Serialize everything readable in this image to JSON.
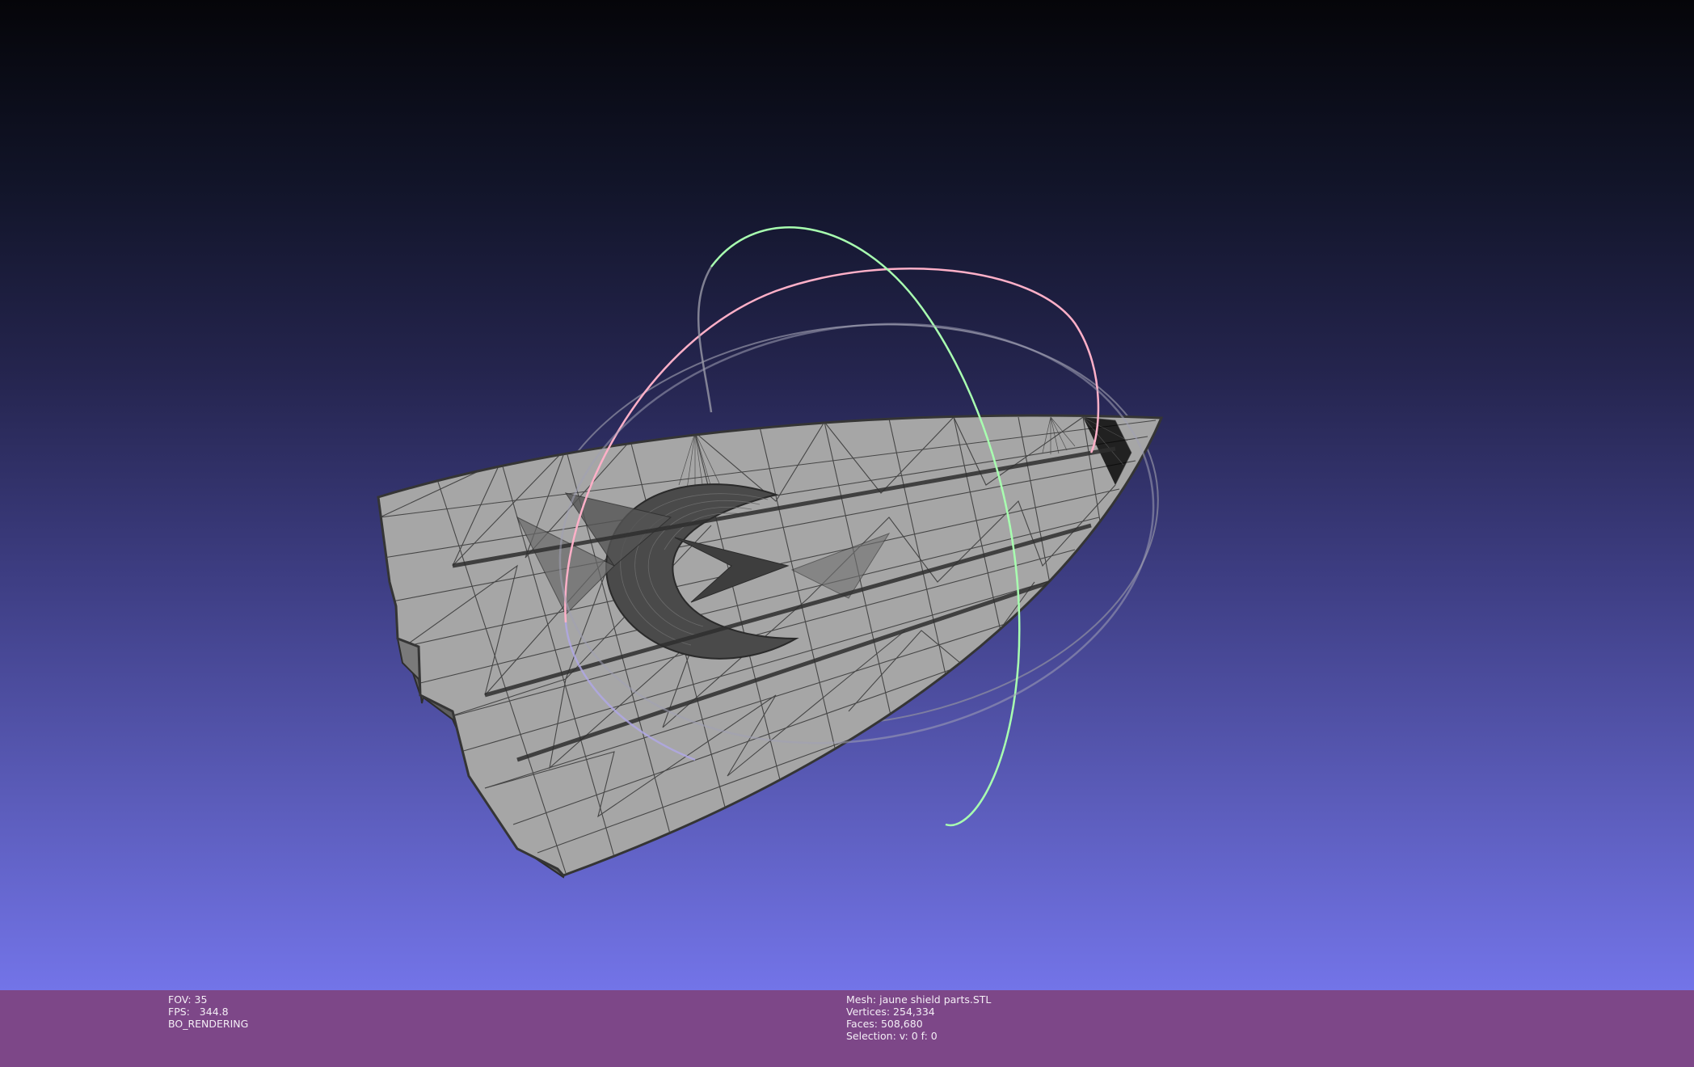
{
  "viewport": {
    "background_top": "#050509",
    "background_bottom": "#7374e8",
    "mesh_fill": "#a6a6a6",
    "wire_color": "#3a3a3a",
    "trackball_colors": {
      "x_ring": "#a8ffb0",
      "y_ring": "#ffb0c8",
      "z_ring": "#9a9aa8"
    }
  },
  "info_bar": {
    "color": "#7d4788",
    "left": {
      "fov": "FOV: 35",
      "fps": "FPS:   344.8",
      "mode": "BO_RENDERING"
    },
    "right": {
      "mesh": "Mesh: jaune shield parts.STL",
      "vertices": "Vertices: 254,334",
      "faces": "Faces: 508,680",
      "selection": "Selection: v: 0 f: 0"
    }
  }
}
